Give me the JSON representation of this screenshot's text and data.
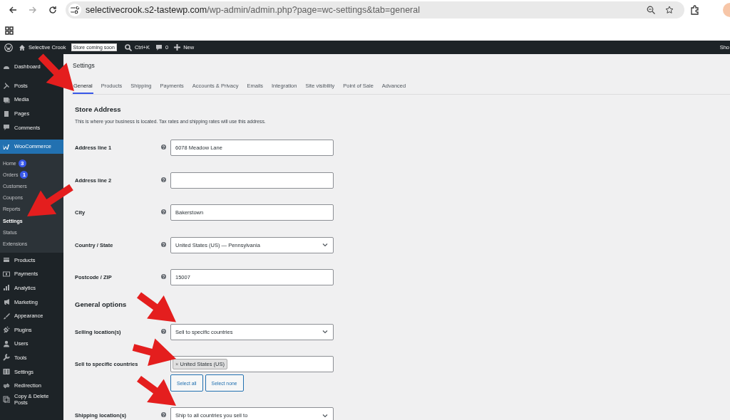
{
  "browser": {
    "url_host": "selectivecrook.s2-tastewp.com",
    "url_path": "/wp-admin/admin.php?page=wc-settings&tab=general"
  },
  "admin_bar": {
    "site": "Selective Crook",
    "badge": "Store coming soon",
    "search": "Ctrl+K",
    "comments": "0",
    "new": "New",
    "right": "Sho"
  },
  "sidebar": {
    "items": [
      {
        "label": "Dashboard",
        "selected": false
      },
      {
        "label": "Posts",
        "selected": false
      },
      {
        "label": "Media",
        "selected": false
      },
      {
        "label": "Pages",
        "selected": false
      },
      {
        "label": "Comments",
        "selected": false
      },
      {
        "label": "WooCommerce",
        "selected": true,
        "children": [
          {
            "label": "Home",
            "badge": "3",
            "selected": false
          },
          {
            "label": "Orders",
            "badge": "1",
            "selected": false
          },
          {
            "label": "Customers",
            "selected": false
          },
          {
            "label": "Coupons",
            "selected": false
          },
          {
            "label": "Reports",
            "selected": false
          },
          {
            "label": "Settings",
            "selected": true
          },
          {
            "label": "Status",
            "selected": false
          },
          {
            "label": "Extensions",
            "selected": false
          }
        ]
      },
      {
        "label": "Products",
        "selected": false
      },
      {
        "label": "Payments",
        "selected": false
      },
      {
        "label": "Analytics",
        "selected": false
      },
      {
        "label": "Marketing",
        "selected": false
      },
      {
        "label": "Appearance",
        "selected": false
      },
      {
        "label": "Plugins",
        "selected": false
      },
      {
        "label": "Users",
        "selected": false
      },
      {
        "label": "Tools",
        "selected": false
      },
      {
        "label": "Settings",
        "selected": false
      },
      {
        "label": "Redirection",
        "selected": false
      },
      {
        "label": "Copy & Delete Posts",
        "selected": false
      }
    ]
  },
  "page_title": "Settings",
  "tabs": [
    {
      "label": "General",
      "selected": true
    },
    {
      "label": "Products",
      "selected": false
    },
    {
      "label": "Shipping",
      "selected": false
    },
    {
      "label": "Payments",
      "selected": false
    },
    {
      "label": "Accounts & Privacy",
      "selected": false
    },
    {
      "label": "Emails",
      "selected": false
    },
    {
      "label": "Integration",
      "selected": false
    },
    {
      "label": "Site visibility",
      "selected": false
    },
    {
      "label": "Point of Sale",
      "selected": false
    },
    {
      "label": "Advanced",
      "selected": false
    }
  ],
  "sections": [
    {
      "heading": "Store Address",
      "description": "This is where your business is located. Tax rates and shipping rates will use this address.",
      "fields": [
        {
          "label": "Address line 1",
          "kind": "text",
          "help": true,
          "value": "6078 Meadow Lane"
        },
        {
          "label": "Address line 2",
          "kind": "text",
          "help": true
        },
        {
          "label": "City",
          "kind": "text",
          "help": true,
          "value": "Bakerstown"
        },
        {
          "label": "Country / State",
          "kind": "select",
          "help": true,
          "value": "United States (US) — Pennsylvania"
        },
        {
          "label": "Postcode / ZIP",
          "kind": "text",
          "help": true,
          "value": "15007"
        }
      ]
    },
    {
      "heading": "General options",
      "fields": [
        {
          "label": "Selling location(s)",
          "kind": "select",
          "help": true,
          "value": "Sell to specific countries"
        },
        {
          "label": "Sell to specific countries",
          "kind": "multiselect",
          "help": false,
          "chips": [
            {
              "remove": "×",
              "label": "United States (US)"
            }
          ],
          "buttons": [
            "Select all",
            "Select none"
          ]
        },
        {
          "label": "Shipping location(s)",
          "kind": "select",
          "help": true,
          "value": "Ship to all countries you sell to"
        }
      ]
    }
  ]
}
